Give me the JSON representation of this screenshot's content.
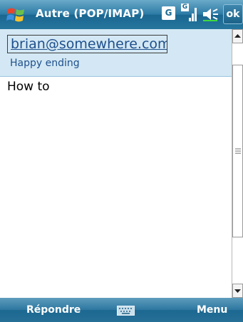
{
  "titlebar": {
    "title": "Autre (POP/IMAP)",
    "network_badge": "G",
    "signal_badge": "G",
    "ok_label": "ok",
    "icons": [
      "windows-start-icon",
      "network-g-icon",
      "signal-strength-icon",
      "speaker-icon"
    ]
  },
  "message": {
    "sender": "brian@somewhere.com",
    "subject": "Happy ending",
    "body": "How to"
  },
  "softkeys": {
    "left": "Répondre",
    "right": "Menu",
    "center_icon": "keyboard-icon"
  },
  "colors": {
    "titlebar": "#2b7aa5",
    "header_bg": "#d3e8f4",
    "link_text": "#1f4f8c"
  }
}
